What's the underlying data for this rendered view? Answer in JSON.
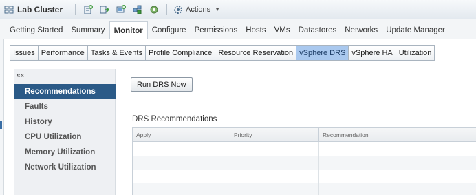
{
  "header": {
    "title": "Lab Cluster",
    "icons": [
      "cluster-icon",
      "add-host-icon",
      "move-into-icon",
      "new-vm-icon",
      "new-vapp-icon",
      "settings-icon"
    ],
    "actions_label": "Actions"
  },
  "main_tabs": [
    {
      "label": "Getting Started",
      "active": false
    },
    {
      "label": "Summary",
      "active": false
    },
    {
      "label": "Monitor",
      "active": true
    },
    {
      "label": "Configure",
      "active": false
    },
    {
      "label": "Permissions",
      "active": false
    },
    {
      "label": "Hosts",
      "active": false
    },
    {
      "label": "VMs",
      "active": false
    },
    {
      "label": "Datastores",
      "active": false
    },
    {
      "label": "Networks",
      "active": false
    },
    {
      "label": "Update Manager",
      "active": false
    }
  ],
  "sub_tabs": [
    {
      "label": "Issues",
      "active": false
    },
    {
      "label": "Performance",
      "active": false
    },
    {
      "label": "Tasks & Events",
      "active": false
    },
    {
      "label": "Profile Compliance",
      "active": false
    },
    {
      "label": "Resource Reservation",
      "active": false
    },
    {
      "label": "vSphere DRS",
      "active": true
    },
    {
      "label": "vSphere HA",
      "active": false
    },
    {
      "label": "Utilization",
      "active": false
    }
  ],
  "left_nav": {
    "collapse_glyph": "««",
    "items": [
      {
        "label": "Recommendations",
        "active": true
      },
      {
        "label": "Faults",
        "active": false
      },
      {
        "label": "History",
        "active": false
      },
      {
        "label": "CPU Utilization",
        "active": false
      },
      {
        "label": "Memory Utilization",
        "active": false
      },
      {
        "label": "Network Utilization",
        "active": false
      }
    ]
  },
  "content": {
    "run_button": "Run DRS Now",
    "section_title": "DRS Recommendations",
    "columns": [
      "Apply",
      "Priority",
      "Recommendation"
    ],
    "empty_rows": 4
  },
  "colors": {
    "active_nav_bg": "#2b5a87",
    "active_subtab_bg": "#a9c8ee",
    "header_border": "#c8d0d8"
  }
}
